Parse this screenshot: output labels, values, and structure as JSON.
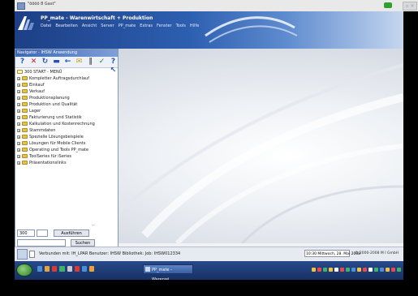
{
  "window": {
    "title": "\"öööö 8 Gast\""
  },
  "app": {
    "title": "PP_mate - Warenwirtschaft + Produktion",
    "menu": [
      "Datei",
      "Bearbeiten",
      "Ansicht",
      "Server",
      "PP_mate",
      "Extras",
      "Fenster",
      "Tools",
      "Hilfe"
    ]
  },
  "navigator": {
    "title": "Navigator - IHSW Anwendung",
    "tree": [
      {
        "label": "300  START - MENÜ",
        "root": true
      },
      {
        "label": "Kompletter Auftragsdurchlauf"
      },
      {
        "label": "Einkauf"
      },
      {
        "label": "Verkauf"
      },
      {
        "label": "Produktionsplanung"
      },
      {
        "label": "Produktion und Qualität"
      },
      {
        "label": "Lager"
      },
      {
        "label": "Fakturierung und Statistik"
      },
      {
        "label": "Kalkulation und Kostenrechnung"
      },
      {
        "label": "Stammdaten"
      },
      {
        "label": "Spezielle Lösungsbeispiele"
      },
      {
        "label": "Lösungen für Mobile Clients"
      },
      {
        "label": "Operating und Tools PP_mate"
      },
      {
        "label": "ToolSeries für iSeries"
      },
      {
        "label": "Präsentationslinks"
      }
    ],
    "search": {
      "value": "300",
      "button1": "Ausführen",
      "button2": "Suchen"
    }
  },
  "status": {
    "text": "Verbunden mit: IH_LPAR  Benutzer: IHSW  Bibliothek: Job: IHSW012334",
    "datetime": "10:30 Mittwoch, 28. Mai 2008",
    "copyright": "© 2000-2008 M I GmbH"
  },
  "taskbar": {
    "app_label": "PP_mate - Warenwi..."
  },
  "colors": {
    "header": "#2d5fb0",
    "taskbar": "#183064"
  }
}
